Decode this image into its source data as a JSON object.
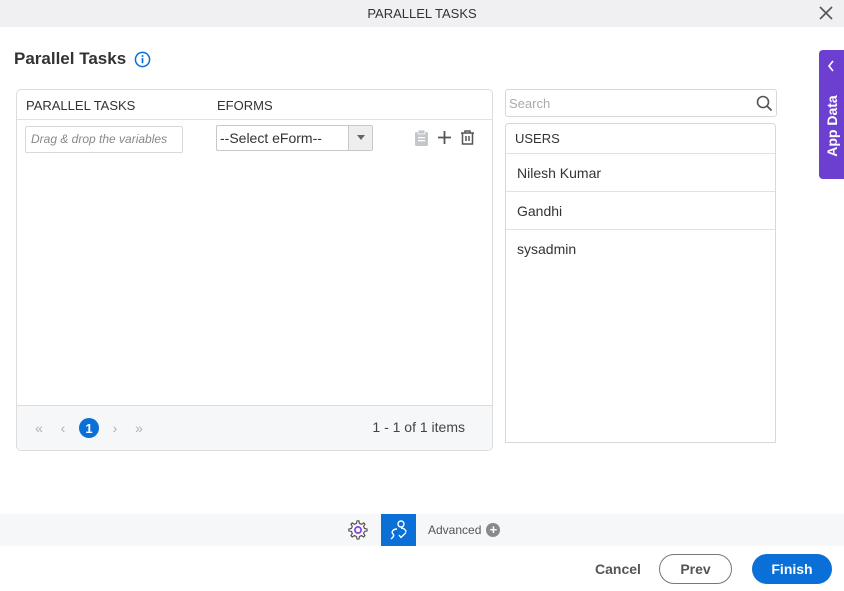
{
  "window": {
    "title": "PARALLEL TASKS",
    "close_icon": "close-icon"
  },
  "page": {
    "title": "Parallel Tasks",
    "info_icon": "info-icon"
  },
  "grid": {
    "columns": [
      "PARALLEL TASKS",
      "EFORMS"
    ],
    "rows": [
      {
        "task_placeholder": "Drag & drop the variables",
        "eform_selected": "--Select eForm--",
        "actions": [
          "clipboard-icon",
          "add-icon",
          "delete-icon"
        ]
      }
    ],
    "pager": {
      "current_page": "1",
      "info": "1 - 1 of 1 items"
    }
  },
  "search": {
    "placeholder": "Search",
    "value": ""
  },
  "users": {
    "header": "USERS",
    "items": [
      "Nilesh Kumar",
      "Gandhi",
      "sysadmin"
    ]
  },
  "app_data": {
    "label": "App Data"
  },
  "toolbar": {
    "advanced_label": "Advanced"
  },
  "footer": {
    "cancel": "Cancel",
    "prev": "Prev",
    "finish": "Finish"
  },
  "colors": {
    "primary": "#0a6fd6",
    "app_data": "#6d3fd0"
  }
}
